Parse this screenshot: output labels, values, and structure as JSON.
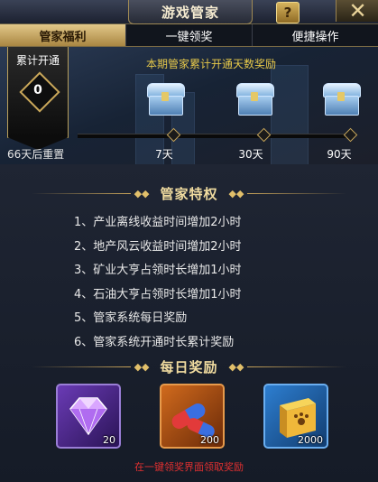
{
  "window": {
    "title": "游戏管家",
    "help_label": "?",
    "close_label": "✕",
    "help_icon": "question-icon",
    "close_icon": "close-icon"
  },
  "tabs": [
    {
      "label": "管家福利",
      "active": true
    },
    {
      "label": "一键领奖",
      "active": false
    },
    {
      "label": "便捷操作",
      "active": false
    }
  ],
  "cumulative": {
    "label": "累计开通",
    "days_value": "0",
    "reset_text": "66天后重置"
  },
  "promo_text": "本期管家累计开通天数奖励",
  "milestones": [
    {
      "label": "7天",
      "reward_icon": "chest-icon"
    },
    {
      "label": "30天",
      "reward_icon": "chest-icon"
    },
    {
      "label": "90天",
      "reward_icon": "chest-icon"
    }
  ],
  "privileges": {
    "title": "管家特权",
    "items": [
      "1、产业离线收益时间增加2小时",
      "2、地产风云收益时间增加2小时",
      "3、矿业大亨占领时长增加1小时",
      "4、石油大亨占领时长增加1小时",
      "5、管家系统每日奖励",
      "6、管家系统开通时长累计奖励"
    ]
  },
  "daily": {
    "title": "每日奖励",
    "items": [
      {
        "icon": "gem-icon",
        "qty": "20"
      },
      {
        "icon": "pill-icon",
        "qty": "200"
      },
      {
        "icon": "pet-food-box-icon",
        "qty": "2000"
      }
    ],
    "hint": "在一键领奖界面领取奖励"
  },
  "colors": {
    "accent_gold": "#e1bf6a",
    "promo_yellow": "#e7c94a",
    "hint_red": "#e03030"
  }
}
